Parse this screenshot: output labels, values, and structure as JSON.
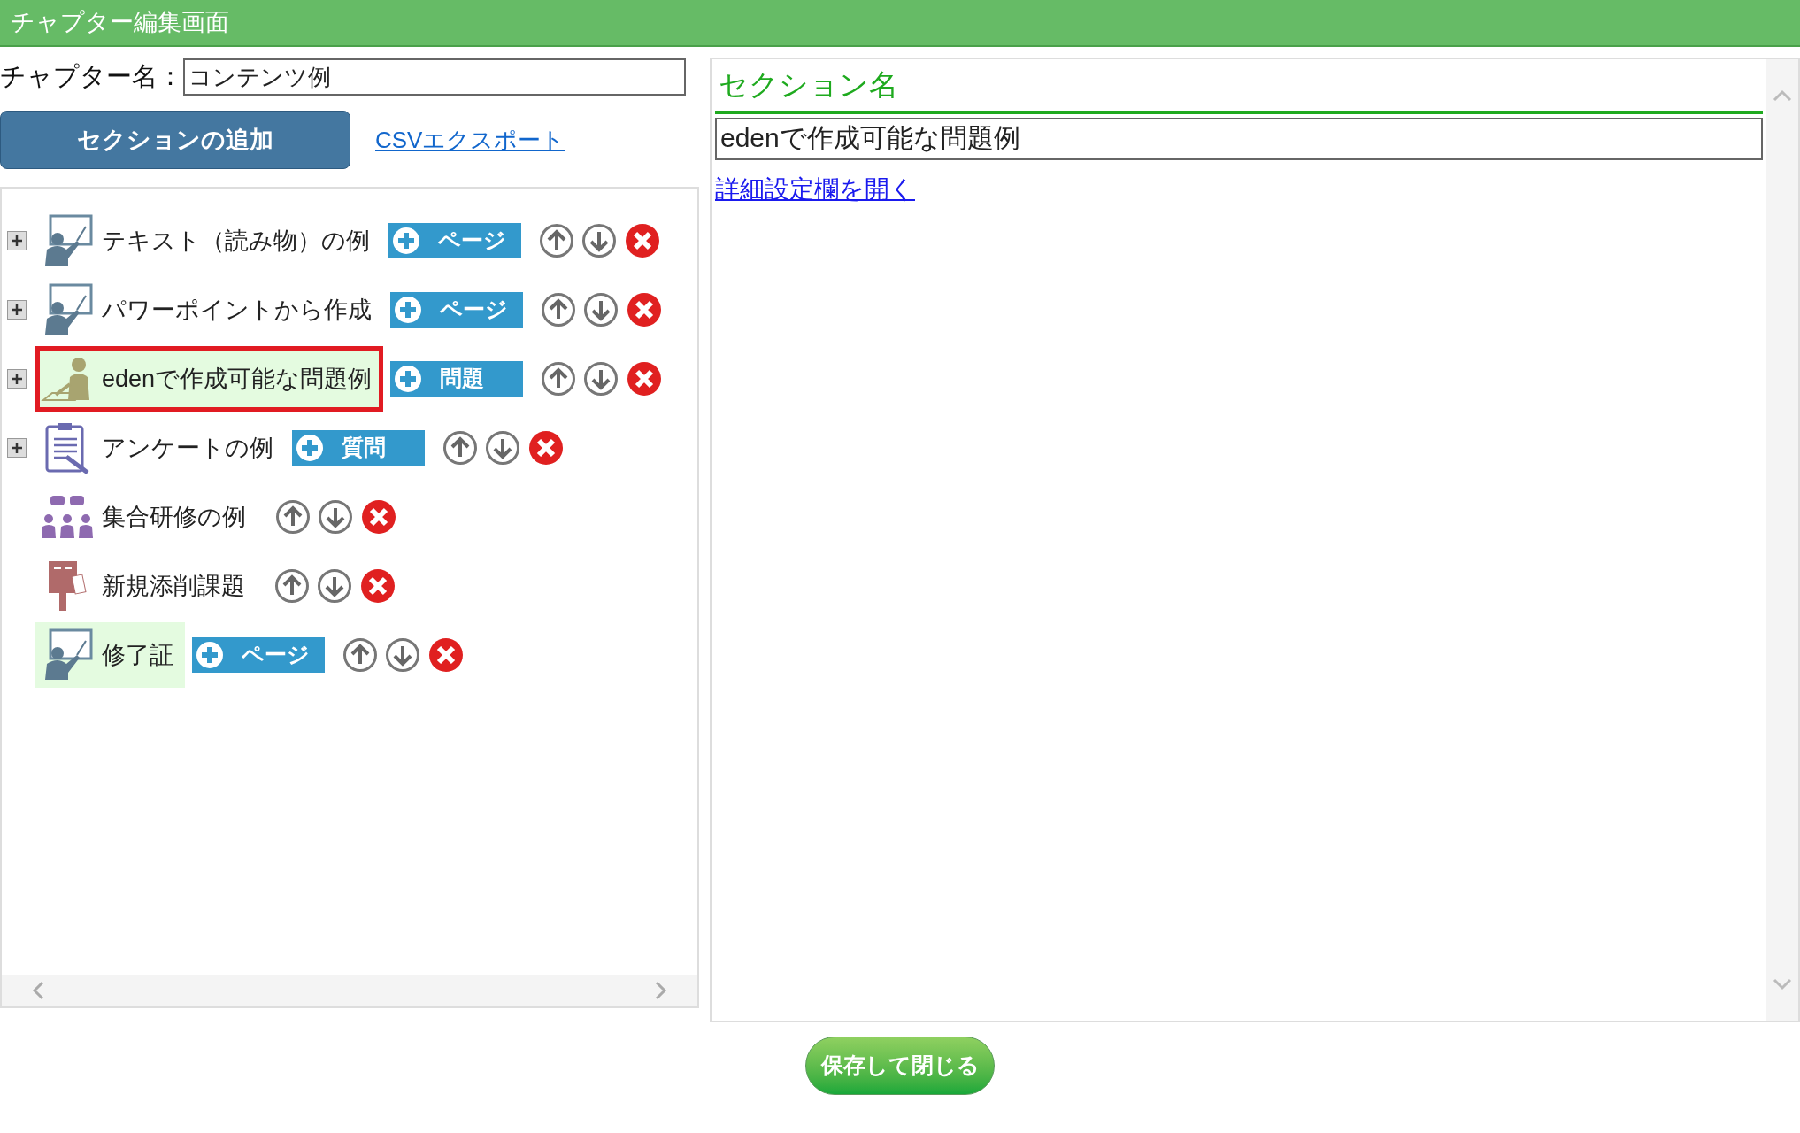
{
  "window": {
    "title": "チャプター編集画面"
  },
  "chapter": {
    "label": "チャプター名：",
    "value": "コンテンツ例"
  },
  "toolbar": {
    "add_section": "セクションの追加",
    "csv_export": "CSVエクスポート"
  },
  "tree": [
    {
      "label": "テキスト（読み物）の例",
      "kind": "lecture",
      "expandable": true,
      "selected": false,
      "highlighted": false,
      "add_button": "ページ"
    },
    {
      "label": "パワーポイントから作成",
      "kind": "lecture",
      "expandable": true,
      "selected": false,
      "highlighted": false,
      "add_button": "ページ"
    },
    {
      "label": "edenで作成可能な問題例",
      "kind": "exam",
      "expandable": true,
      "selected": true,
      "highlighted": true,
      "add_button": "問題"
    },
    {
      "label": "アンケートの例",
      "kind": "survey",
      "expandable": true,
      "selected": false,
      "highlighted": false,
      "add_button": "質問"
    },
    {
      "label": "集合研修の例",
      "kind": "training",
      "expandable": false,
      "selected": false,
      "highlighted": false
    },
    {
      "label": "新規添削課題",
      "kind": "post",
      "expandable": false,
      "selected": false,
      "highlighted": false
    },
    {
      "label": "修了証",
      "kind": "lecture",
      "expandable": false,
      "selected": false,
      "highlighted": true,
      "add_button": "ページ"
    }
  ],
  "section": {
    "heading": "セクション名",
    "name": "edenで作成可能な問題例",
    "details_link": "詳細設定欄を開く"
  },
  "footer": {
    "save_button": "保存して閉じる"
  }
}
